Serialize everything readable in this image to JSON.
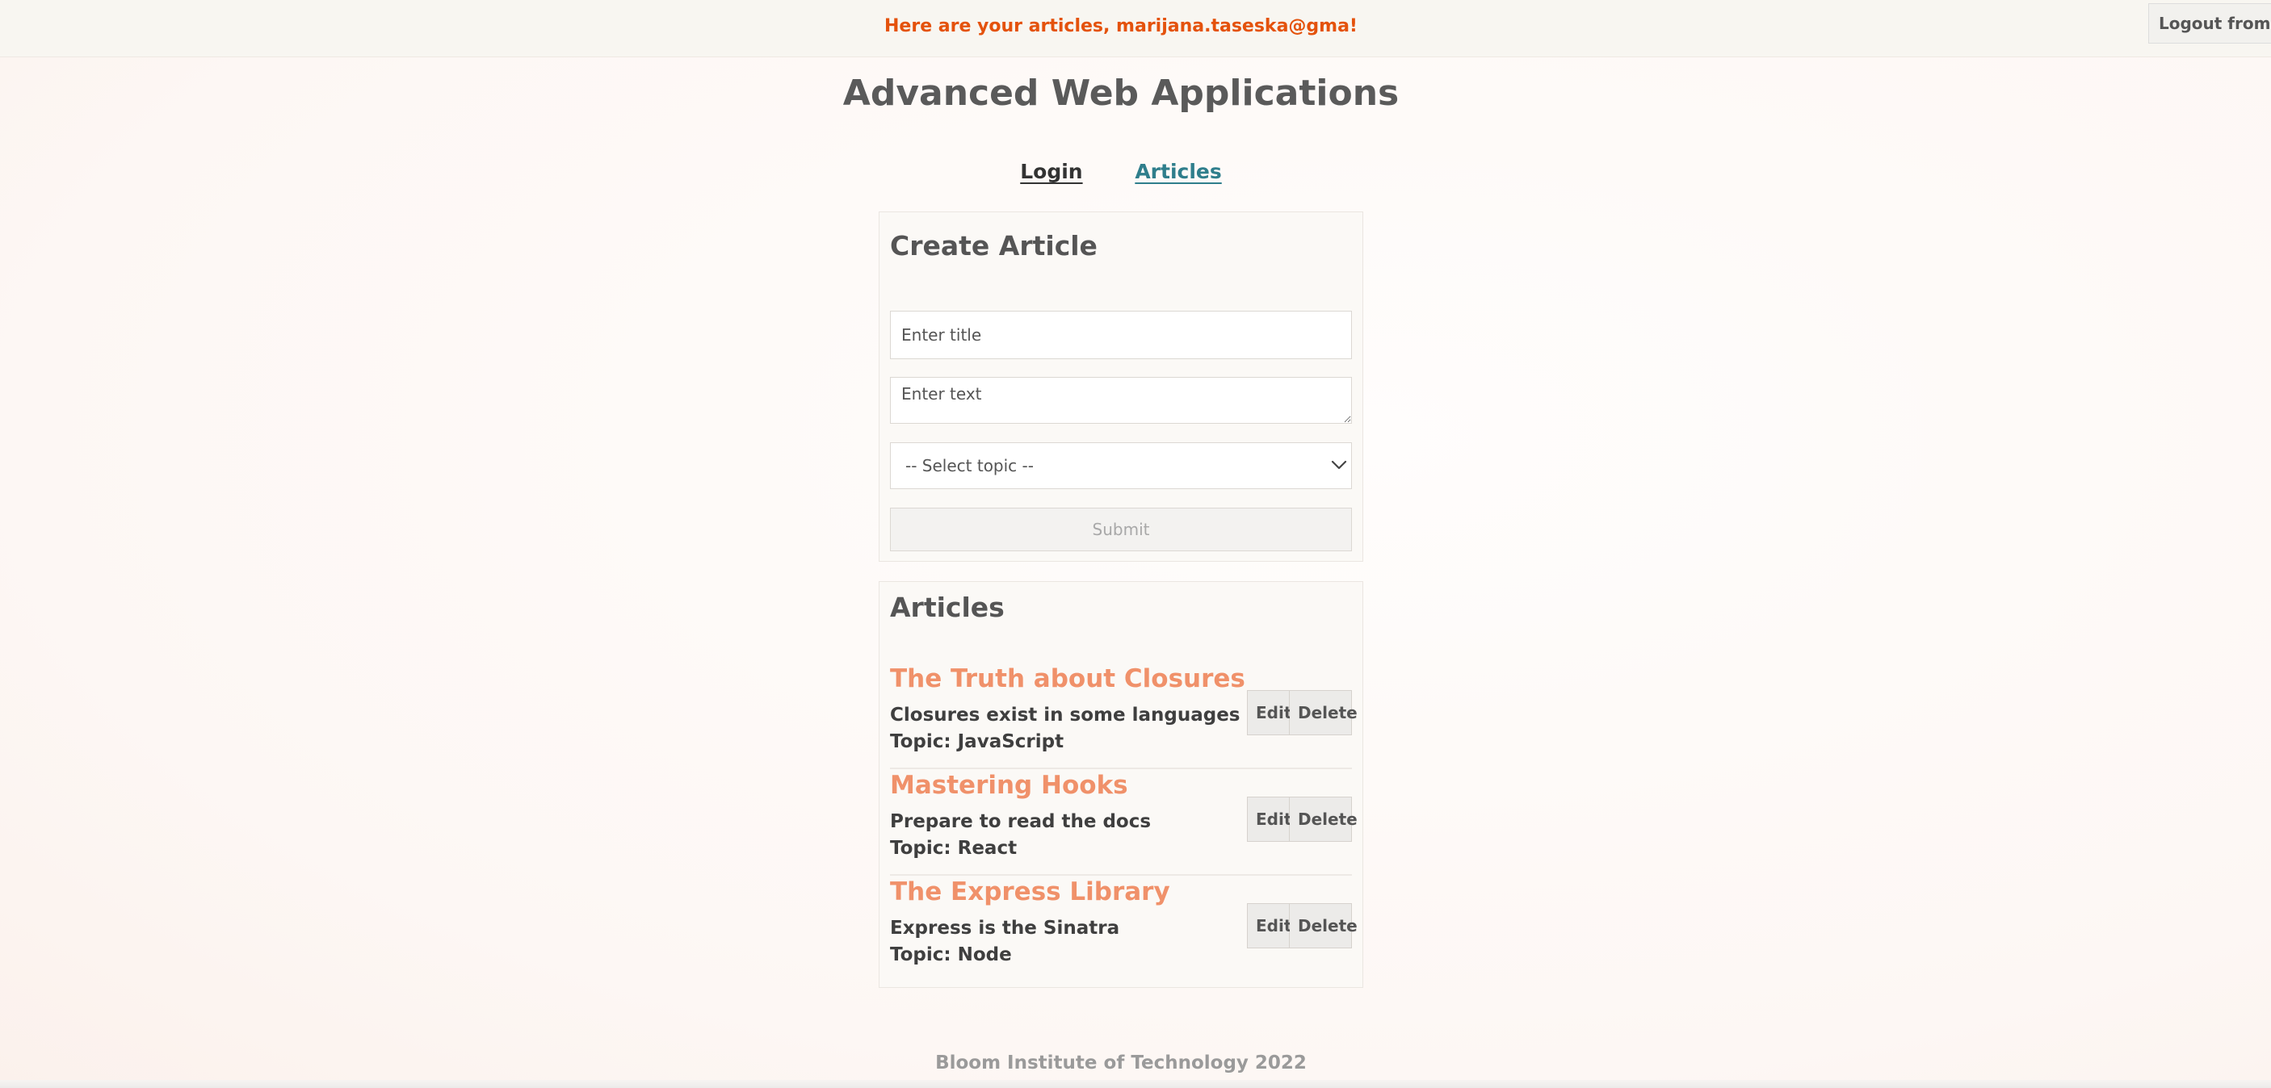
{
  "header": {
    "welcome_message": "Here are your articles, marijana.taseska@gma!",
    "logout_label": "Logout from app"
  },
  "page_title": "Advanced Web Applications",
  "nav": {
    "login": "Login",
    "articles": "Articles"
  },
  "create_form": {
    "heading": "Create Article",
    "title_placeholder": "Enter title",
    "title_value": "",
    "text_placeholder": "Enter text",
    "text_value": "",
    "topic_selected": "-- Select topic --",
    "submit_label": "Submit"
  },
  "articles": {
    "heading": "Articles",
    "edit_label": "Edit",
    "delete_label": "Delete",
    "items": [
      {
        "title": "The Truth about Closures",
        "text": "Closures exist in some languages",
        "topic": "Topic: JavaScript"
      },
      {
        "title": "Mastering Hooks",
        "text": "Prepare to read the docs",
        "topic": "Topic: React"
      },
      {
        "title": "The Express Library",
        "text": "Express is the Sinatra",
        "topic": "Topic: Node"
      }
    ]
  },
  "footer": "Bloom Institute of Technology 2022",
  "colors": {
    "welcome": "#e4520c",
    "article_title": "#f0916a",
    "nav_active": "#2f7e8c"
  }
}
